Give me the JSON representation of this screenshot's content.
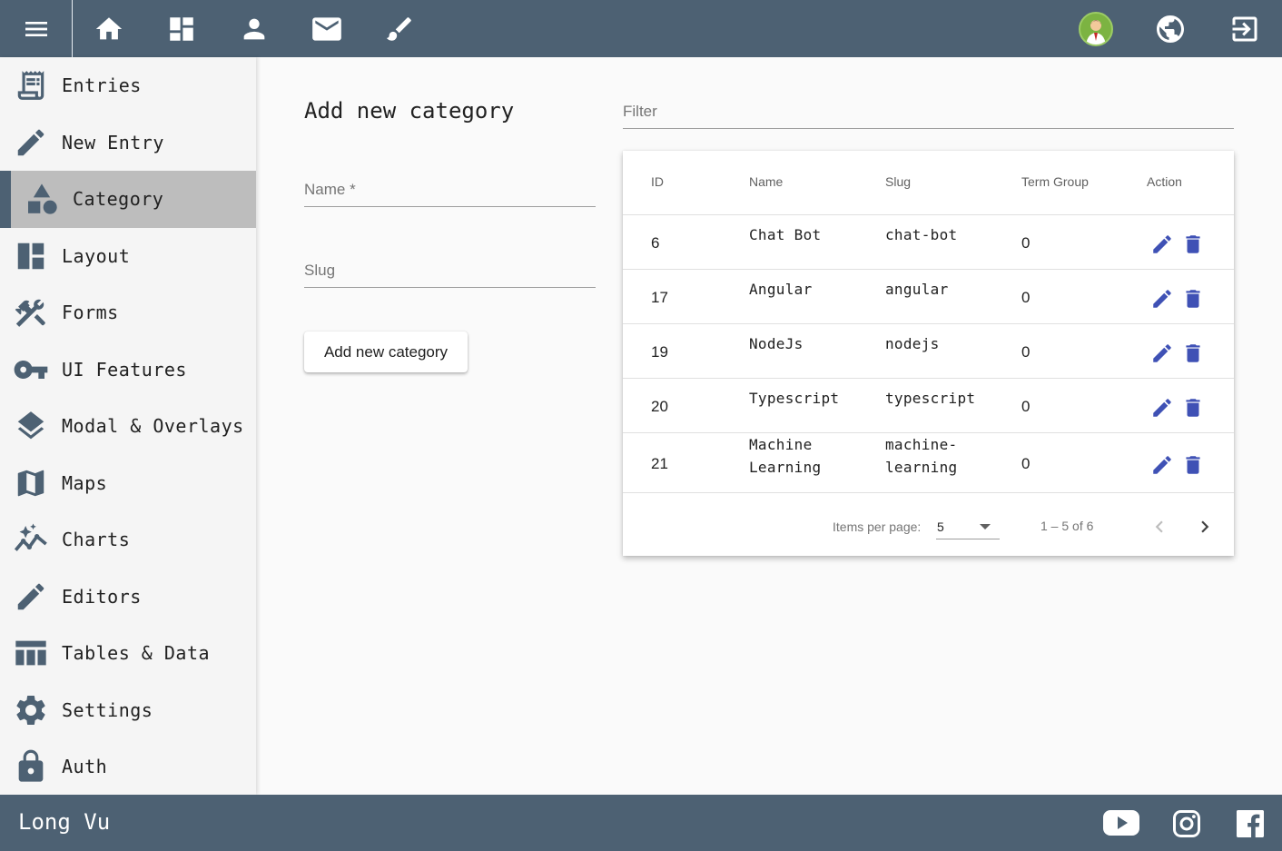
{
  "topbar": {
    "icons": [
      "menu-icon",
      "home-icon",
      "dashboard-icon",
      "person-icon",
      "mail-icon",
      "brush-icon"
    ],
    "right_icons": [
      "avatar",
      "globe-icon",
      "logout-icon"
    ]
  },
  "sidebar": {
    "items": [
      {
        "label": "Entries",
        "icon": "receipt-icon"
      },
      {
        "label": "New Entry",
        "icon": "pencil-icon"
      },
      {
        "label": "Category",
        "icon": "category-icon",
        "active": true
      },
      {
        "label": "Layout",
        "icon": "layout-icon"
      },
      {
        "label": "Forms",
        "icon": "tools-icon"
      },
      {
        "label": "UI Features",
        "icon": "key-icon"
      },
      {
        "label": "Modal & Overlays",
        "icon": "layers-icon"
      },
      {
        "label": "Maps",
        "icon": "map-icon"
      },
      {
        "label": "Charts",
        "icon": "chart-icon"
      },
      {
        "label": "Editors",
        "icon": "pencil-icon"
      },
      {
        "label": "Tables & Data",
        "icon": "table-icon"
      },
      {
        "label": "Settings",
        "icon": "gear-icon"
      },
      {
        "label": "Auth",
        "icon": "lock-icon"
      }
    ]
  },
  "form": {
    "title": "Add new category",
    "name_placeholder": "Name *",
    "slug_placeholder": "Slug",
    "submit_label": "Add new category"
  },
  "filter": {
    "placeholder": "Filter"
  },
  "table": {
    "columns": [
      "ID",
      "Name",
      "Slug",
      "Term Group",
      "Action"
    ],
    "rows": [
      {
        "id": "6",
        "name": "Chat Bot",
        "slug": "chat-bot",
        "term_group": "0"
      },
      {
        "id": "17",
        "name": "Angular",
        "slug": "angular",
        "term_group": "0"
      },
      {
        "id": "19",
        "name": "NodeJs",
        "slug": "nodejs",
        "term_group": "0"
      },
      {
        "id": "20",
        "name": "Typescript",
        "slug": "typescript",
        "term_group": "0"
      },
      {
        "id": "21",
        "name": "Machine Learning",
        "name_lines": [
          "Machine",
          "Learning"
        ],
        "slug": "machine-learning",
        "slug_lines": [
          "machine-",
          "learning"
        ],
        "term_group": "0"
      }
    ]
  },
  "paginator": {
    "items_per_page_label": "Items per page:",
    "page_size": "5",
    "range_label": "1 – 5 of 6"
  },
  "footer": {
    "name": "Long Vu",
    "social": [
      "youtube-icon",
      "instagram-icon",
      "facebook-icon"
    ]
  },
  "colors": {
    "toolbar": "#4d6173",
    "sidebar_bg": "#f5f5f5",
    "active_item": "#bdbdbd",
    "action_icon": "#3f51b5"
  }
}
